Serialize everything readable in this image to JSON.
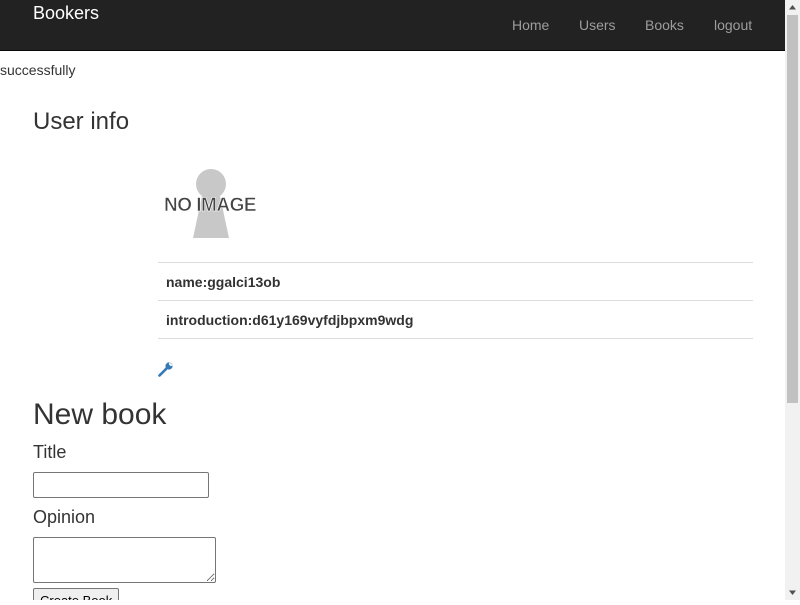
{
  "navbar": {
    "brand": "Bookers",
    "links": [
      {
        "label": "Home"
      },
      {
        "label": "Users"
      },
      {
        "label": "Books"
      },
      {
        "label": "logout"
      }
    ]
  },
  "flash": {
    "message": "successfully"
  },
  "user_info": {
    "heading": "User info",
    "image_text": "NO IMAGE",
    "name_row": "name:ggalci13ob",
    "introduction_row": "introduction:d61y169vyfdjbpxm9wdg",
    "edit_icon": "wrench-icon"
  },
  "new_book": {
    "heading": "New book",
    "title_label": "Title",
    "title_value": "",
    "opinion_label": "Opinion",
    "opinion_value": "",
    "submit_label": "Create Book"
  },
  "colors": {
    "navbar_bg": "#222222",
    "nav_link": "#9d9d9d",
    "brand": "#ffffff",
    "link_blue": "#337ab7"
  },
  "icons": {
    "edit": "wrench-icon",
    "scroll_up": "scroll-up-arrow-icon",
    "scroll_down": "scroll-down-arrow-icon"
  }
}
